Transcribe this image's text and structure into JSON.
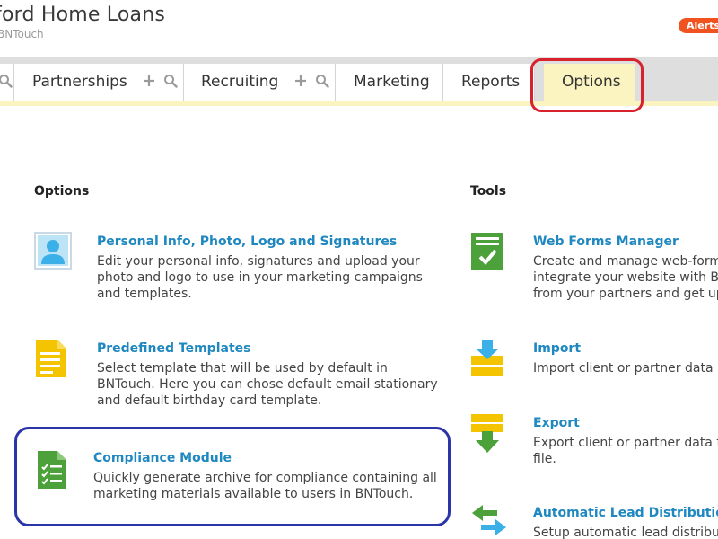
{
  "header": {
    "company_name": "ford Home Loans",
    "product_name": "BNTouch",
    "alert_label": "Alerts"
  },
  "nav": {
    "tabs": [
      {
        "label": "Partnerships"
      },
      {
        "label": "Recruiting"
      },
      {
        "label": "Marketing"
      },
      {
        "label": "Reports"
      },
      {
        "label": "Options"
      }
    ],
    "active_tab": "Options"
  },
  "options": {
    "heading": "Options",
    "items": [
      {
        "title": "Personal Info, Photo, Logo and Signatures",
        "desc_lines": [
          "Edit your personal info, signatures and upload your",
          "photo and logo to use in your marketing campaigns",
          "and templates."
        ],
        "icon": "user-profile-icon"
      },
      {
        "title": "Predefined Templates",
        "desc_lines": [
          "Select template that will be used by default in",
          "BNTouch. Here you can chose default email stationary",
          "and default birthday card template."
        ],
        "icon": "document-template-icon"
      },
      {
        "title": "Compliance Module",
        "desc_lines": [
          "Quickly generate archive for compliance containing all",
          "marketing materials available to users in BNTouch."
        ],
        "icon": "checklist-document-icon"
      }
    ]
  },
  "tools": {
    "heading": "Tools",
    "items": [
      {
        "title": "Web Forms Manager",
        "desc_lines": [
          "Create and manage web-forms",
          "integrate your website with BNTouch",
          "from your partners and get up"
        ],
        "icon": "web-form-check-icon"
      },
      {
        "title": "Import",
        "desc_lines": [
          "Import client or partner data using"
        ],
        "icon": "import-icon"
      },
      {
        "title": "Export",
        "desc_lines": [
          "Export client or partner data from",
          "file."
        ],
        "icon": "export-icon"
      },
      {
        "title": "Automatic Lead Distribution",
        "desc_lines": [
          "Setup automatic lead distribution"
        ],
        "icon": "lead-distribution-arrows-icon"
      }
    ]
  },
  "colors": {
    "link_blue": "#1f88c0",
    "nav_yellow": "#fbf3c0",
    "alert_orange": "#f0531f",
    "highlight_red": "#d8232f",
    "highlight_blue": "#2c35a8",
    "icon_green": "#4ca13a",
    "icon_yellow": "#f5c400",
    "icon_sky": "#3bb0e8"
  }
}
